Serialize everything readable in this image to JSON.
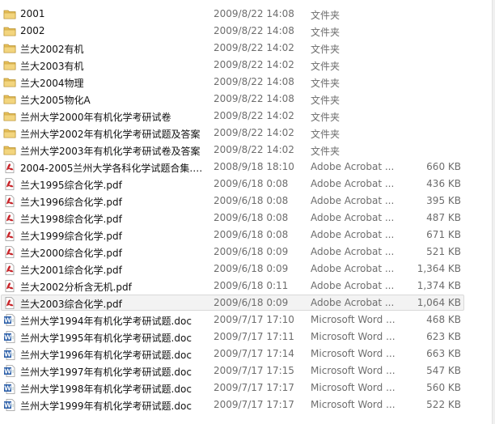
{
  "colors": {
    "folder": "#e8c15a",
    "pdf": "#c8262b",
    "word": "#2a5ea8",
    "selected_bg": "#f3f3f3",
    "meta_text": "#6d6d6d"
  },
  "files": [
    {
      "name": "2001",
      "date": "2009/8/22 14:08",
      "type": "文件夹",
      "size": "",
      "icon": "folder-icon"
    },
    {
      "name": "2002",
      "date": "2009/8/22 14:08",
      "type": "文件夹",
      "size": "",
      "icon": "folder-icon"
    },
    {
      "name": "兰大2002有机",
      "date": "2009/8/22 14:02",
      "type": "文件夹",
      "size": "",
      "icon": "folder-icon"
    },
    {
      "name": "兰大2003有机",
      "date": "2009/8/22 14:02",
      "type": "文件夹",
      "size": "",
      "icon": "folder-icon"
    },
    {
      "name": "兰大2004物理",
      "date": "2009/8/22 14:08",
      "type": "文件夹",
      "size": "",
      "icon": "folder-icon"
    },
    {
      "name": "兰大2005物化A",
      "date": "2009/8/22 14:08",
      "type": "文件夹",
      "size": "",
      "icon": "folder-icon"
    },
    {
      "name": "兰州大学2000年有机化学考研试卷",
      "date": "2009/8/22 14:02",
      "type": "文件夹",
      "size": "",
      "icon": "folder-icon"
    },
    {
      "name": "兰州大学2002年有机化学考研试题及答案",
      "date": "2009/8/22 14:02",
      "type": "文件夹",
      "size": "",
      "icon": "folder-icon"
    },
    {
      "name": "兰州大学2003年有机化学考研试卷及答案",
      "date": "2009/8/22 14:02",
      "type": "文件夹",
      "size": "",
      "icon": "folder-icon"
    },
    {
      "name": "2004-2005兰州大学各科化学试题合集.p...",
      "date": "2008/9/18 18:10",
      "type": "Adobe Acrobat ...",
      "size": "660 KB",
      "icon": "pdf-icon"
    },
    {
      "name": "兰大1995综合化学.pdf",
      "date": "2009/6/18 0:08",
      "type": "Adobe Acrobat ...",
      "size": "436 KB",
      "icon": "pdf-icon"
    },
    {
      "name": "兰大1996综合化学.pdf",
      "date": "2009/6/18 0:08",
      "type": "Adobe Acrobat ...",
      "size": "395 KB",
      "icon": "pdf-icon"
    },
    {
      "name": "兰大1998综合化学.pdf",
      "date": "2009/6/18 0:08",
      "type": "Adobe Acrobat ...",
      "size": "487 KB",
      "icon": "pdf-icon"
    },
    {
      "name": "兰大1999综合化学.pdf",
      "date": "2009/6/18 0:08",
      "type": "Adobe Acrobat ...",
      "size": "671 KB",
      "icon": "pdf-icon"
    },
    {
      "name": "兰大2000综合化学.pdf",
      "date": "2009/6/18 0:09",
      "type": "Adobe Acrobat ...",
      "size": "521 KB",
      "icon": "pdf-icon"
    },
    {
      "name": "兰大2001综合化学.pdf",
      "date": "2009/6/18 0:09",
      "type": "Adobe Acrobat ...",
      "size": "1,364 KB",
      "icon": "pdf-icon"
    },
    {
      "name": "兰大2002分析含无机.pdf",
      "date": "2009/6/18 0:11",
      "type": "Adobe Acrobat ...",
      "size": "1,374 KB",
      "icon": "pdf-icon"
    },
    {
      "name": "兰大2003综合化学.pdf",
      "date": "2009/6/18 0:09",
      "type": "Adobe Acrobat ...",
      "size": "1,064 KB",
      "icon": "pdf-icon",
      "selected": true
    },
    {
      "name": "兰州大学1994年有机化学考研试题.doc",
      "date": "2009/7/17 17:10",
      "type": "Microsoft Word ...",
      "size": "468 KB",
      "icon": "word-doc-icon"
    },
    {
      "name": "兰州大学1995年有机化学考研试题.doc",
      "date": "2009/7/17 17:11",
      "type": "Microsoft Word ...",
      "size": "623 KB",
      "icon": "word-doc-icon"
    },
    {
      "name": "兰州大学1996年有机化学考研试题.doc",
      "date": "2009/7/17 17:14",
      "type": "Microsoft Word ...",
      "size": "663 KB",
      "icon": "word-doc-icon"
    },
    {
      "name": "兰州大学1997年有机化学考研试题.doc",
      "date": "2009/7/17 17:15",
      "type": "Microsoft Word ...",
      "size": "547 KB",
      "icon": "word-doc-icon"
    },
    {
      "name": "兰州大学1998年有机化学考研试题.doc",
      "date": "2009/7/17 17:17",
      "type": "Microsoft Word ...",
      "size": "560 KB",
      "icon": "word-doc-icon"
    },
    {
      "name": "兰州大学1999年有机化学考研试题.doc",
      "date": "2009/7/17 17:17",
      "type": "Microsoft Word ...",
      "size": "522 KB",
      "icon": "word-doc-icon"
    }
  ]
}
